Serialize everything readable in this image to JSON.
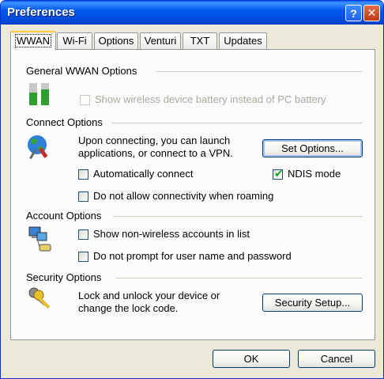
{
  "window": {
    "title": "Preferences"
  },
  "titlebar_buttons": {
    "help": "?",
    "close": "✕"
  },
  "tabs": [
    {
      "label": "WWAN",
      "active": true
    },
    {
      "label": "Wi-Fi"
    },
    {
      "label": "Options"
    },
    {
      "label": "Venturi"
    },
    {
      "label": "TXT"
    },
    {
      "label": "Updates"
    }
  ],
  "general": {
    "title": "General WWAN Options",
    "battery_checkbox": {
      "label": "Show wireless device battery instead of PC battery",
      "checked": false,
      "enabled": false
    }
  },
  "connect": {
    "title": "Connect Options",
    "description_line1": "Upon connecting, you can launch",
    "description_line2": "applications, or connect to a VPN.",
    "set_options_button": "Set Options...",
    "auto_connect": {
      "label": "Automatically connect",
      "checked": false
    },
    "ndis_mode": {
      "label": "NDIS mode",
      "checked": true
    },
    "no_roaming": {
      "label": "Do not allow connectivity when roaming",
      "checked": false
    }
  },
  "account": {
    "title": "Account Options",
    "show_non_wireless": {
      "label": "Show non-wireless accounts in list",
      "checked": false
    },
    "no_prompt": {
      "label": "Do not prompt for user name and password",
      "checked": false
    }
  },
  "security": {
    "title": "Security Options",
    "description_line1": "Lock and unlock your device or",
    "description_line2": "change the lock code.",
    "setup_button": "Security Setup..."
  },
  "footer": {
    "ok": "OK",
    "cancel": "Cancel"
  },
  "colors": {
    "titlebar": "#0058ee",
    "dialog_bg": "#ece9d8",
    "panel_bg": "#fcfcfe",
    "tab_highlight": "#ffc83c",
    "checkmark": "#21a121"
  }
}
